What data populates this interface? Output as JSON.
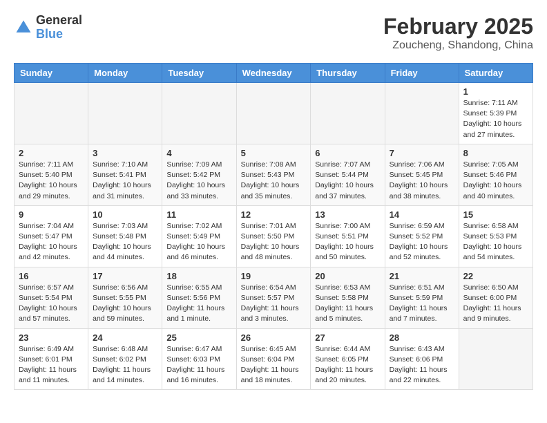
{
  "header": {
    "logo_general": "General",
    "logo_blue": "Blue",
    "title": "February 2025",
    "subtitle": "Zoucheng, Shandong, China"
  },
  "weekdays": [
    "Sunday",
    "Monday",
    "Tuesday",
    "Wednesday",
    "Thursday",
    "Friday",
    "Saturday"
  ],
  "weeks": [
    [
      {
        "day": "",
        "info": ""
      },
      {
        "day": "",
        "info": ""
      },
      {
        "day": "",
        "info": ""
      },
      {
        "day": "",
        "info": ""
      },
      {
        "day": "",
        "info": ""
      },
      {
        "day": "",
        "info": ""
      },
      {
        "day": "1",
        "info": "Sunrise: 7:11 AM\nSunset: 5:39 PM\nDaylight: 10 hours\nand 27 minutes."
      }
    ],
    [
      {
        "day": "2",
        "info": "Sunrise: 7:11 AM\nSunset: 5:40 PM\nDaylight: 10 hours\nand 29 minutes."
      },
      {
        "day": "3",
        "info": "Sunrise: 7:10 AM\nSunset: 5:41 PM\nDaylight: 10 hours\nand 31 minutes."
      },
      {
        "day": "4",
        "info": "Sunrise: 7:09 AM\nSunset: 5:42 PM\nDaylight: 10 hours\nand 33 minutes."
      },
      {
        "day": "5",
        "info": "Sunrise: 7:08 AM\nSunset: 5:43 PM\nDaylight: 10 hours\nand 35 minutes."
      },
      {
        "day": "6",
        "info": "Sunrise: 7:07 AM\nSunset: 5:44 PM\nDaylight: 10 hours\nand 37 minutes."
      },
      {
        "day": "7",
        "info": "Sunrise: 7:06 AM\nSunset: 5:45 PM\nDaylight: 10 hours\nand 38 minutes."
      },
      {
        "day": "8",
        "info": "Sunrise: 7:05 AM\nSunset: 5:46 PM\nDaylight: 10 hours\nand 40 minutes."
      }
    ],
    [
      {
        "day": "9",
        "info": "Sunrise: 7:04 AM\nSunset: 5:47 PM\nDaylight: 10 hours\nand 42 minutes."
      },
      {
        "day": "10",
        "info": "Sunrise: 7:03 AM\nSunset: 5:48 PM\nDaylight: 10 hours\nand 44 minutes."
      },
      {
        "day": "11",
        "info": "Sunrise: 7:02 AM\nSunset: 5:49 PM\nDaylight: 10 hours\nand 46 minutes."
      },
      {
        "day": "12",
        "info": "Sunrise: 7:01 AM\nSunset: 5:50 PM\nDaylight: 10 hours\nand 48 minutes."
      },
      {
        "day": "13",
        "info": "Sunrise: 7:00 AM\nSunset: 5:51 PM\nDaylight: 10 hours\nand 50 minutes."
      },
      {
        "day": "14",
        "info": "Sunrise: 6:59 AM\nSunset: 5:52 PM\nDaylight: 10 hours\nand 52 minutes."
      },
      {
        "day": "15",
        "info": "Sunrise: 6:58 AM\nSunset: 5:53 PM\nDaylight: 10 hours\nand 54 minutes."
      }
    ],
    [
      {
        "day": "16",
        "info": "Sunrise: 6:57 AM\nSunset: 5:54 PM\nDaylight: 10 hours\nand 57 minutes."
      },
      {
        "day": "17",
        "info": "Sunrise: 6:56 AM\nSunset: 5:55 PM\nDaylight: 10 hours\nand 59 minutes."
      },
      {
        "day": "18",
        "info": "Sunrise: 6:55 AM\nSunset: 5:56 PM\nDaylight: 11 hours\nand 1 minute."
      },
      {
        "day": "19",
        "info": "Sunrise: 6:54 AM\nSunset: 5:57 PM\nDaylight: 11 hours\nand 3 minutes."
      },
      {
        "day": "20",
        "info": "Sunrise: 6:53 AM\nSunset: 5:58 PM\nDaylight: 11 hours\nand 5 minutes."
      },
      {
        "day": "21",
        "info": "Sunrise: 6:51 AM\nSunset: 5:59 PM\nDaylight: 11 hours\nand 7 minutes."
      },
      {
        "day": "22",
        "info": "Sunrise: 6:50 AM\nSunset: 6:00 PM\nDaylight: 11 hours\nand 9 minutes."
      }
    ],
    [
      {
        "day": "23",
        "info": "Sunrise: 6:49 AM\nSunset: 6:01 PM\nDaylight: 11 hours\nand 11 minutes."
      },
      {
        "day": "24",
        "info": "Sunrise: 6:48 AM\nSunset: 6:02 PM\nDaylight: 11 hours\nand 14 minutes."
      },
      {
        "day": "25",
        "info": "Sunrise: 6:47 AM\nSunset: 6:03 PM\nDaylight: 11 hours\nand 16 minutes."
      },
      {
        "day": "26",
        "info": "Sunrise: 6:45 AM\nSunset: 6:04 PM\nDaylight: 11 hours\nand 18 minutes."
      },
      {
        "day": "27",
        "info": "Sunrise: 6:44 AM\nSunset: 6:05 PM\nDaylight: 11 hours\nand 20 minutes."
      },
      {
        "day": "28",
        "info": "Sunrise: 6:43 AM\nSunset: 6:06 PM\nDaylight: 11 hours\nand 22 minutes."
      },
      {
        "day": "",
        "info": ""
      }
    ]
  ]
}
